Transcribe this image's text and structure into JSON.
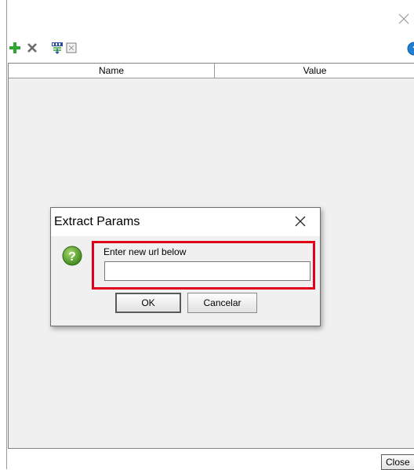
{
  "window": {
    "close_icon": "close-icon"
  },
  "toolbar": {
    "add_icon": "add-icon",
    "remove_icon": "remove-icon",
    "extract_url_icon": "url-extract-icon",
    "clear_icon": "clear-icon",
    "help_icon": "help-icon"
  },
  "table": {
    "columns": [
      "Name",
      "Value"
    ],
    "rows": []
  },
  "footer": {
    "close_label": "Close"
  },
  "dialog": {
    "title": "Extract Params",
    "prompt": "Enter new url below",
    "input_value": "",
    "ok_label": "OK",
    "cancel_label": "Cancelar",
    "highlight_color": "#e0001a"
  },
  "colors": {
    "add": "#2fa62f",
    "remove": "#6b6b6b",
    "help": "#1f7fd0",
    "question": "#5aa02c"
  }
}
